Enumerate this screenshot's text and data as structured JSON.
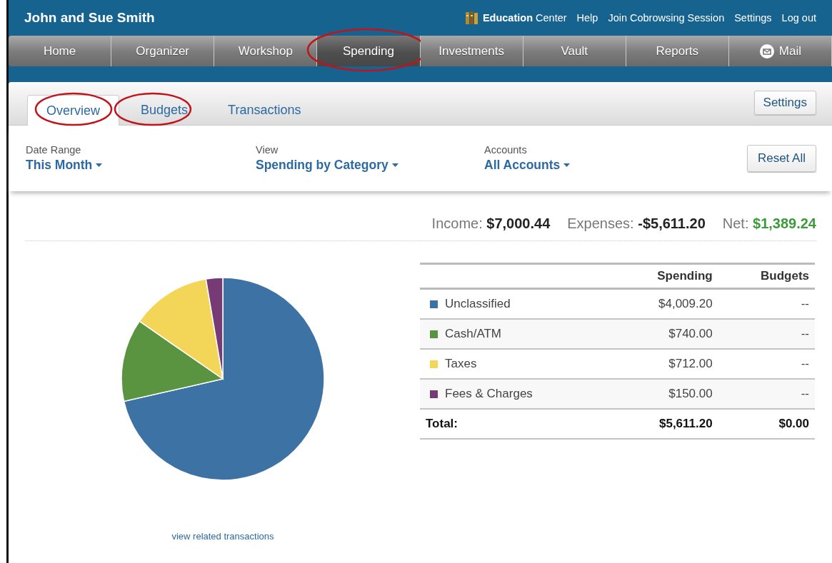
{
  "header": {
    "user": "John and Sue Smith",
    "links": [
      {
        "label": "**Education** Center",
        "kind": "book"
      },
      {
        "label": "Help",
        "kind": "plain"
      },
      {
        "label": "Join Cobrowsing Session",
        "kind": "plain"
      },
      {
        "label": "Settings",
        "kind": "plain"
      },
      {
        "label": "Log out",
        "kind": "plain"
      }
    ]
  },
  "nav": [
    {
      "label": "Home",
      "selected": false,
      "circled": false,
      "kind": "plain"
    },
    {
      "label": "Organizer",
      "selected": false,
      "circled": false,
      "kind": "plain"
    },
    {
      "label": "Workshop",
      "selected": false,
      "circled": false,
      "kind": "plain"
    },
    {
      "label": "Spending",
      "selected": true,
      "circled": true,
      "kind": "plain"
    },
    {
      "label": "Investments",
      "selected": false,
      "circled": false,
      "kind": "plain"
    },
    {
      "label": "Vault",
      "selected": false,
      "circled": false,
      "kind": "plain"
    },
    {
      "label": "Reports",
      "selected": false,
      "circled": false,
      "kind": "plain"
    },
    {
      "label": "Mail",
      "selected": false,
      "circled": false,
      "kind": "mail"
    }
  ],
  "tabs": [
    {
      "label": "Overview",
      "selected": true,
      "circled": true
    },
    {
      "label": "Budgets",
      "selected": false,
      "circled": true
    },
    {
      "label": "Transactions",
      "selected": false,
      "circled": false
    }
  ],
  "settings_button": "Settings",
  "filters": [
    {
      "label": "Date Range",
      "value": "This Month"
    },
    {
      "label": "View",
      "value": "Spending by Category"
    },
    {
      "label": "Accounts",
      "value": "All Accounts"
    }
  ],
  "reset_button": "Reset All",
  "summary": [
    {
      "label": "Income:",
      "value": "$7,000.44",
      "kind": "neutral"
    },
    {
      "label": "Expenses:",
      "value": "-$5,611.20",
      "kind": "neutral"
    },
    {
      "label": "Net:",
      "value": "$1,389.24",
      "kind": "positive"
    }
  ],
  "table": {
    "columns": [
      "Spending",
      "Budgets"
    ],
    "rows": [
      {
        "color": "#3d72a4",
        "spending": "$4,009.20",
        "budget": "--"
      },
      {
        "color": "#5a9440",
        "spending": "$740.00",
        "budget": "--"
      },
      {
        "color": "#f3d557",
        "spending": "$712.00",
        "budget": "--"
      },
      {
        "color": "#763b74",
        "spending": "$150.00",
        "budget": "--"
      }
    ],
    "total": {
      "label": "Total:",
      "spending": "$5,611.20",
      "budget": "$0.00"
    }
  },
  "chart_data": {
    "type": "pie",
    "categories": [
      "Unclassified",
      "Cash/ATM",
      "Taxes",
      "Fees & Charges"
    ],
    "values": [
      71.45,
      13.19,
      12.69,
      2.67
    ]
  },
  "link": "view related transactions"
}
